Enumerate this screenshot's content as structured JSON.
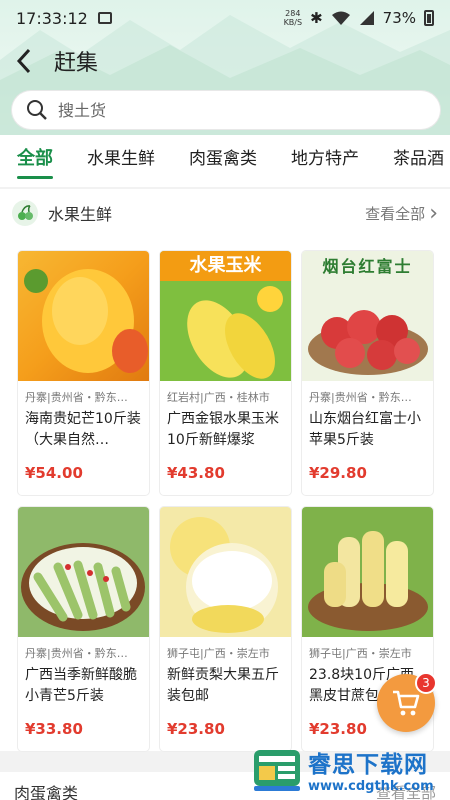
{
  "status_bar": {
    "time": "17:33:12",
    "speed_value": "284",
    "speed_unit": "KB/S",
    "battery": "73%"
  },
  "header": {
    "title": "赶集"
  },
  "search": {
    "placeholder": "搜土货"
  },
  "tabs": [
    {
      "label": "全部",
      "active": true
    },
    {
      "label": "水果生鲜",
      "active": false
    },
    {
      "label": "肉蛋禽类",
      "active": false
    },
    {
      "label": "地方特产",
      "active": false
    },
    {
      "label": "茶品酒",
      "active": false
    }
  ],
  "section": {
    "title": "水果生鲜",
    "more": "查看全部"
  },
  "products": [
    {
      "location": "丹寨|贵州省・黔东…",
      "name": "海南贵妃芒10斤装（大果自然…",
      "price": "¥54.00",
      "banner": ""
    },
    {
      "location": "红岩村|广西・桂林市",
      "name": "广西金银水果玉米10斤新鲜爆浆",
      "price": "¥43.80",
      "banner": "水果玉米"
    },
    {
      "location": "丹寨|贵州省・黔东…",
      "name": "山东烟台红富士小苹果5斤装",
      "price": "¥29.80",
      "banner": "烟台红富士"
    },
    {
      "location": "丹寨|贵州省・黔东…",
      "name": "广西当季新鲜酸脆小青芒5斤装",
      "price": "¥33.80",
      "banner": ""
    },
    {
      "location": "狮子屯|广西・崇左市",
      "name": "新鲜贡梨大果五斤装包邮",
      "price": "¥23.80",
      "banner": ""
    },
    {
      "location": "狮子屯|广西・崇左市",
      "name": "23.8块10斤广西黑皮甘蔗包邮",
      "price": "¥23.80",
      "banner": ""
    }
  ],
  "next_section": {
    "title": "肉蛋禽类",
    "more": "查看全部"
  },
  "cart": {
    "count": "3"
  },
  "watermark": {
    "name": "睿思下载网",
    "url": "www.cdgthk.com"
  },
  "colors": {
    "accent": "#1a8f4a",
    "price": "#e23b2e",
    "cart": "#f39a3f"
  }
}
